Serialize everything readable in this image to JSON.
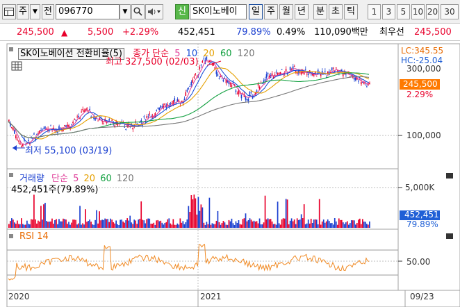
{
  "toolbar": {
    "mode_label": "주",
    "period_label": "전",
    "code_value": "096770",
    "tag_label": "신",
    "stock_name": "SK이노베이",
    "periods": [
      "일",
      "주",
      "월",
      "년",
      "분",
      "초",
      "틱"
    ],
    "active_period": "일",
    "counts": [
      "1",
      "3",
      "5",
      "10",
      "20",
      "30"
    ]
  },
  "price": {
    "current": "245,500",
    "arrow": "▲",
    "change": "5,500",
    "change_pct": "+2.29%",
    "volume": "452,451",
    "vol_ratio": "79.89%",
    "turnover": "0.49%",
    "amount": "110,090백만",
    "best_ask_label": "최우선",
    "best_ask": "245,500"
  },
  "price_panel": {
    "title": "SK이노베이션 전환비율(5)",
    "ma_label": "종가 단순",
    "ma_periods": [
      "5",
      "10",
      "20",
      "60",
      "120"
    ],
    "ma_colors": [
      "#e0409a",
      "#1a4fd8",
      "#e5a000",
      "#12a040",
      "#777777"
    ],
    "high_label": "최고 327,500 (02/03)",
    "low_label": "최저 55,100 (03/19)",
    "lc": "LC:345.55",
    "hc": "HC:-25.04",
    "last_price": "245,500",
    "last_pct": "2.29%",
    "axis_300": "300,000",
    "axis_100": "100,000"
  },
  "volume_panel": {
    "title": "거래량",
    "ma_label": "단순",
    "ma_periods": [
      "5",
      "20",
      "60",
      "120"
    ],
    "current": "452,451주(79.89%)",
    "axis": "5,000K",
    "last_value": "452,451",
    "last_pct": "79.89%"
  },
  "rsi_panel": {
    "title": "RSI 14",
    "axis": "50.00"
  },
  "xaxis": {
    "labels": [
      "2020",
      "2021"
    ],
    "date": "09/23"
  },
  "colors": {
    "up": "#e8002b",
    "down": "#1a3fd0",
    "rsi": "#f08a24",
    "highlight_blue": "#1f5fd6",
    "last_price_bg": "#ff7a00"
  }
}
